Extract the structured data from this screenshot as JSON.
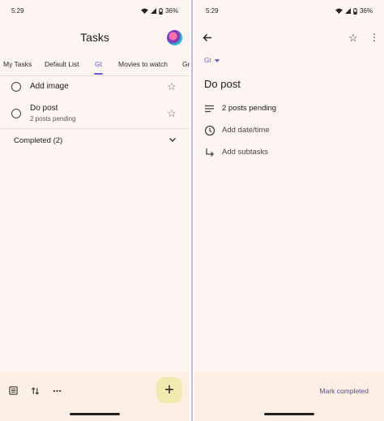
{
  "left": {
    "status": {
      "time": "5:29",
      "battery": "36%"
    },
    "title": "Tasks",
    "tabs": [
      "My Tasks",
      "Default List",
      "Gt",
      "Movies to watch",
      "Gr"
    ],
    "active_tab": "Gt",
    "tasks": [
      {
        "title": "Add image",
        "sub": ""
      },
      {
        "title": "Do post",
        "sub": "2 posts pending"
      }
    ],
    "completed_label": "Completed (2)",
    "fab_label": "+"
  },
  "right": {
    "status": {
      "time": "5:29",
      "battery": "36%"
    },
    "list_name": "Gt",
    "task_title": "Do post",
    "details": "2 posts pending",
    "add_date": "Add date/time",
    "add_subtasks": "Add subtasks",
    "mark_completed": "Mark completed"
  },
  "colors": {
    "accent": "#6b5ad1",
    "background": "#fdf5f2",
    "bottom_bar": "#fbf0e3",
    "fab": "#f0eab0"
  }
}
